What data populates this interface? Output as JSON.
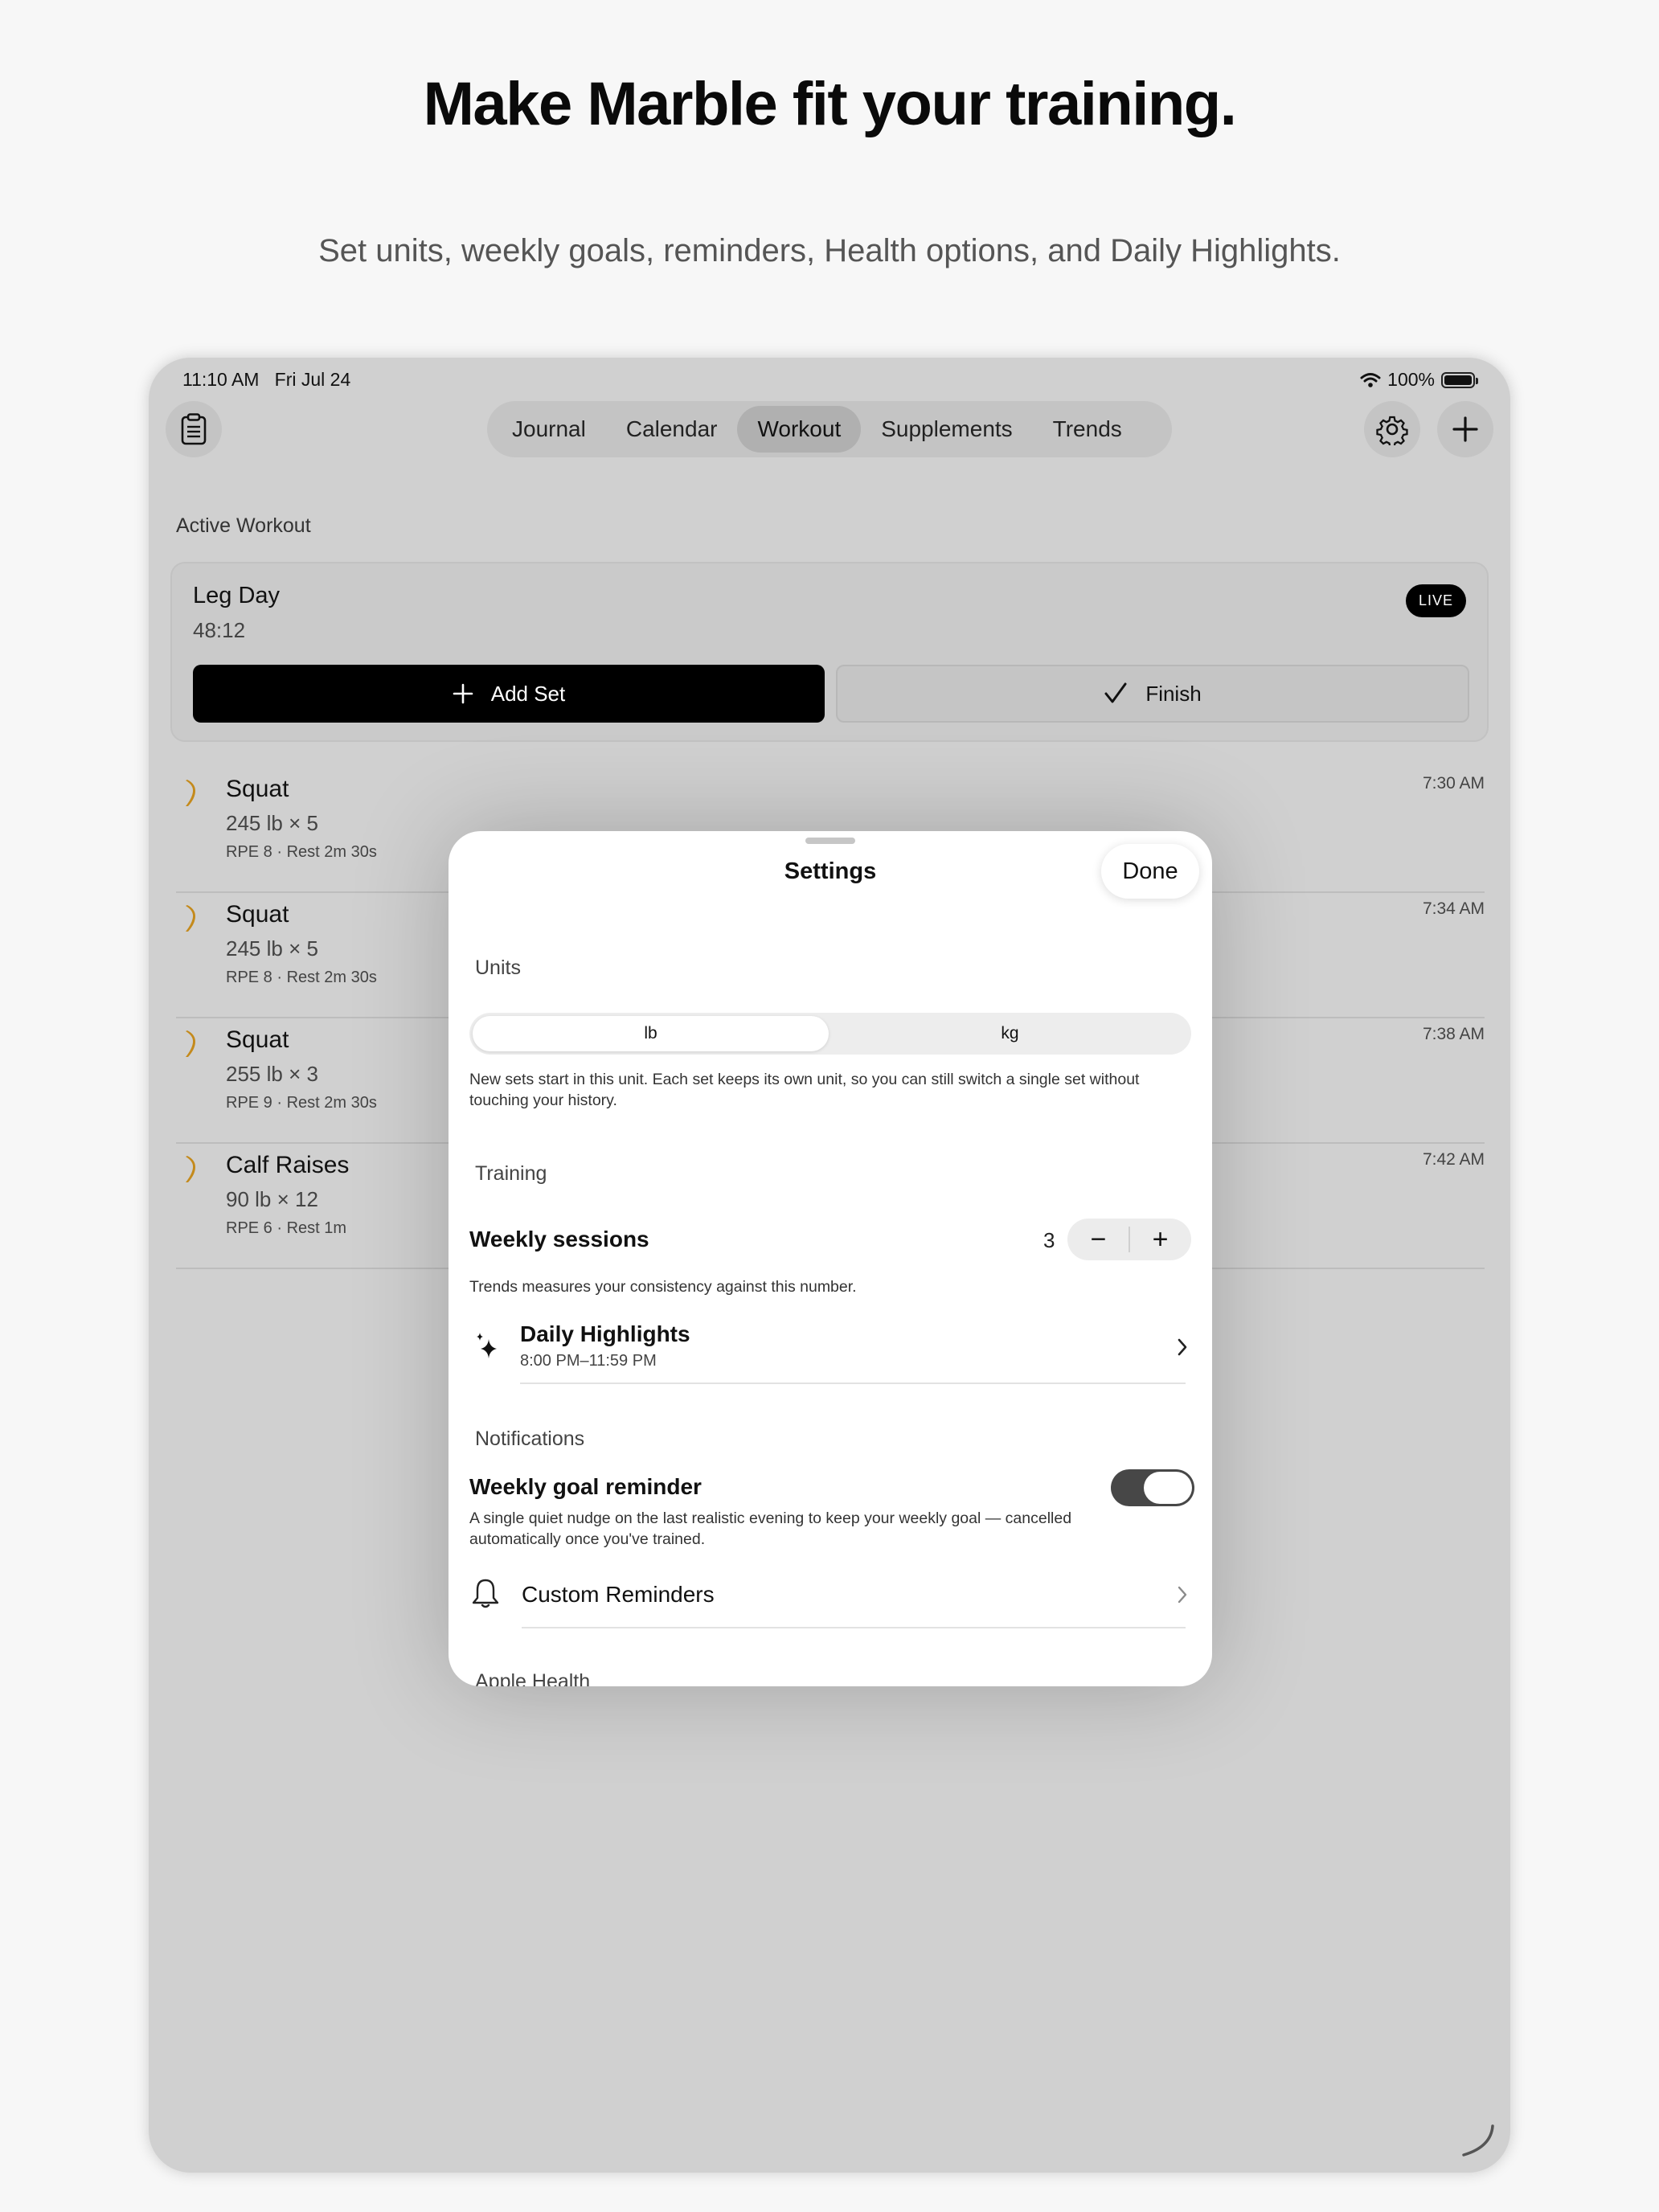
{
  "promo": {
    "headline": "Make Marble fit your training.",
    "subhead": "Set units, weekly goals, reminders, Health options, and Daily Highlights."
  },
  "status_bar": {
    "time": "11:10 AM",
    "date": "Fri Jul 24",
    "battery": "100%"
  },
  "nav": {
    "tabs": [
      {
        "label": "Journal",
        "active": false
      },
      {
        "label": "Calendar",
        "active": false
      },
      {
        "label": "Workout",
        "active": true
      },
      {
        "label": "Supplements",
        "active": false
      },
      {
        "label": "Trends",
        "active": false
      }
    ],
    "left_icon": "clipboard-icon",
    "right_icons": [
      "gear-icon",
      "plus-icon"
    ]
  },
  "active_workout": {
    "section_label": "Active Workout",
    "title": "Leg Day",
    "timer": "48:12",
    "badge": "LIVE",
    "add_set_label": "Add Set",
    "finish_label": "Finish"
  },
  "exercises": [
    {
      "name": "Squat",
      "weight": "245 lb × 5",
      "meta": "RPE 8 · Rest 2m 30s",
      "time": "7:30 AM"
    },
    {
      "name": "Squat",
      "weight": "245 lb × 5",
      "meta": "RPE 8 · Rest 2m 30s",
      "time": "7:34 AM"
    },
    {
      "name": "Squat",
      "weight": "255 lb × 3",
      "meta": "RPE 9 · Rest 2m 30s",
      "time": "7:38 AM"
    },
    {
      "name": "Calf Raises",
      "weight": "90 lb × 12",
      "meta": "RPE 6 · Rest 1m",
      "time": "7:42 AM"
    }
  ],
  "settings": {
    "title": "Settings",
    "done_label": "Done",
    "units": {
      "label": "Units",
      "options": [
        "lb",
        "kg"
      ],
      "selected": "lb",
      "note": "New sets start in this unit. Each set keeps its own unit, so you can still switch a single set without touching your history."
    },
    "training": {
      "label": "Training",
      "weekly_sessions_label": "Weekly sessions",
      "weekly_sessions_value": "3",
      "minus": "−",
      "plus": "+",
      "note": "Trends measures your consistency against this number.",
      "daily_highlights_label": "Daily Highlights",
      "daily_highlights_time": "8:00 PM–11:59 PM"
    },
    "notifications": {
      "label": "Notifications",
      "weekly_goal_label": "Weekly goal reminder",
      "weekly_goal_enabled": true,
      "weekly_goal_note": "A single quiet nudge on the last realistic evening to keep your weekly goal — cancelled automatically once you've trained.",
      "custom_reminders_label": "Custom Reminders"
    },
    "apple_health_label": "Apple Health"
  }
}
